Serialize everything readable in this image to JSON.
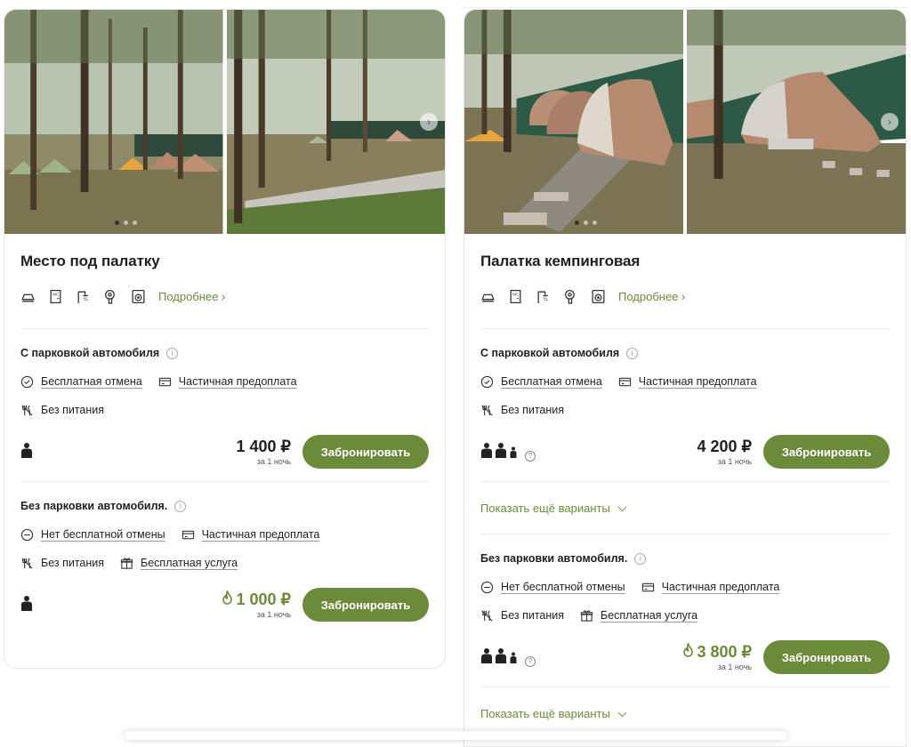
{
  "colors": {
    "accent": "#6b8a3a",
    "text": "#1f1f1f",
    "divider": "#ececec"
  },
  "cards": [
    {
      "title": "Место под палатку",
      "amenities": [
        "iron-icon",
        "wc-icon",
        "shower-icon",
        "hairdryer-icon",
        "washing-machine-icon"
      ],
      "more_label": "Подробнее",
      "tariffs": [
        {
          "title": "С парковкой автомобиля",
          "conditions": [
            {
              "icon": "check-circle-icon",
              "label": "Бесплатная отмена",
              "underline": true
            },
            {
              "icon": "card-icon",
              "label": "Частичная предоплата",
              "underline": true
            }
          ],
          "conditions2": [
            {
              "icon": "no-food-icon",
              "label": "Без питания",
              "underline": false
            }
          ],
          "guests": {
            "adults": 1,
            "children": 0
          },
          "price": "1 400 ₽",
          "price_sub": "за 1 ночь",
          "hot": false,
          "book_label": "Забронировать"
        },
        {
          "title": "Без парковки автомобиля.",
          "conditions": [
            {
              "icon": "minus-circle-icon",
              "label": "Нет бесплатной отмены",
              "underline": true
            },
            {
              "icon": "card-icon",
              "label": "Частичная предоплата",
              "underline": true
            }
          ],
          "conditions2": [
            {
              "icon": "no-food-icon",
              "label": "Без питания",
              "underline": false
            },
            {
              "icon": "gift-icon",
              "label": "Бесплатная услуга",
              "underline": true
            }
          ],
          "guests": {
            "adults": 1,
            "children": 0
          },
          "price": "1 000 ₽",
          "price_sub": "за 1 ночь",
          "hot": true,
          "book_label": "Забронировать"
        }
      ]
    },
    {
      "title": "Палатка кемпинговая",
      "amenities": [
        "iron-icon",
        "wc-icon",
        "shower-icon",
        "hairdryer-icon",
        "washing-machine-icon"
      ],
      "more_label": "Подробнее",
      "show_more_label": "Показать ещё варианты",
      "tariffs": [
        {
          "title": "С парковкой автомобиля",
          "conditions": [
            {
              "icon": "check-circle-icon",
              "label": "Бесплатная отмена",
              "underline": true
            },
            {
              "icon": "card-icon",
              "label": "Частичная предоплата",
              "underline": true
            }
          ],
          "conditions2": [
            {
              "icon": "no-food-icon",
              "label": "Без питания",
              "underline": false
            }
          ],
          "guests": {
            "adults": 2,
            "children": 1
          },
          "price": "4 200 ₽",
          "price_sub": "за 1 ночь",
          "hot": false,
          "book_label": "Забронировать"
        },
        {
          "title": "Без парковки автомобиля.",
          "conditions": [
            {
              "icon": "minus-circle-icon",
              "label": "Нет бесплатной отмены",
              "underline": true
            },
            {
              "icon": "card-icon",
              "label": "Частичная предоплата",
              "underline": true
            }
          ],
          "conditions2": [
            {
              "icon": "no-food-icon",
              "label": "Без питания",
              "underline": false
            },
            {
              "icon": "gift-icon",
              "label": "Бесплатная услуга",
              "underline": true
            }
          ],
          "guests": {
            "adults": 2,
            "children": 1
          },
          "price": "3 800 ₽",
          "price_sub": "за 1 ночь",
          "hot": true,
          "book_label": "Забронировать"
        }
      ]
    }
  ]
}
